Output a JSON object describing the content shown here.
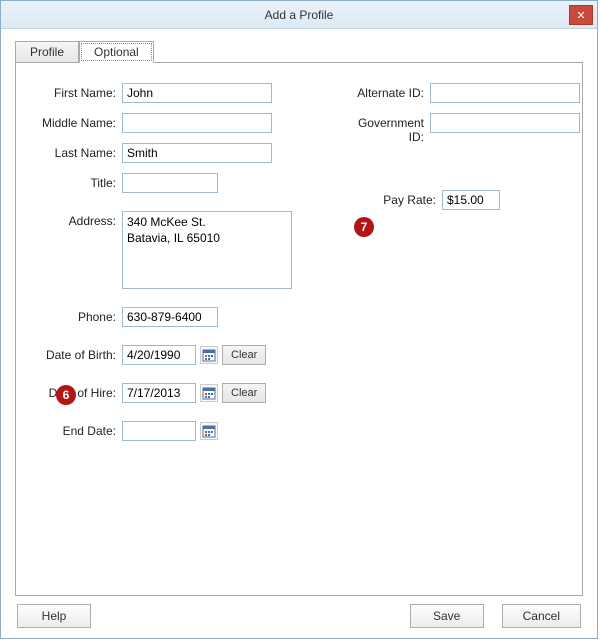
{
  "window": {
    "title": "Add a Profile"
  },
  "tabs": {
    "profile": "Profile",
    "optional": "Optional"
  },
  "labels": {
    "first_name": "First Name:",
    "middle_name": "Middle Name:",
    "last_name": "Last Name:",
    "title": "Title:",
    "address": "Address:",
    "phone": "Phone:",
    "dob": "Date of Birth:",
    "doh": "Date of Hire:",
    "end_date": "End Date:",
    "alt_id": "Alternate ID:",
    "gov_id": "Government ID:",
    "pay_rate": "Pay Rate:"
  },
  "values": {
    "first_name": "John",
    "middle_name": "",
    "last_name": "Smith",
    "title": "",
    "address": "340 McKee St.\nBatavia, IL 65010",
    "phone": "630-879-6400",
    "dob": "4/20/1990",
    "doh": "7/17/2013",
    "end_date": "",
    "alt_id": "",
    "gov_id": "",
    "pay_rate": "$15.00"
  },
  "buttons": {
    "clear": "Clear",
    "help": "Help",
    "save": "Save",
    "cancel": "Cancel"
  },
  "annotations": {
    "six": "6",
    "seven": "7"
  }
}
